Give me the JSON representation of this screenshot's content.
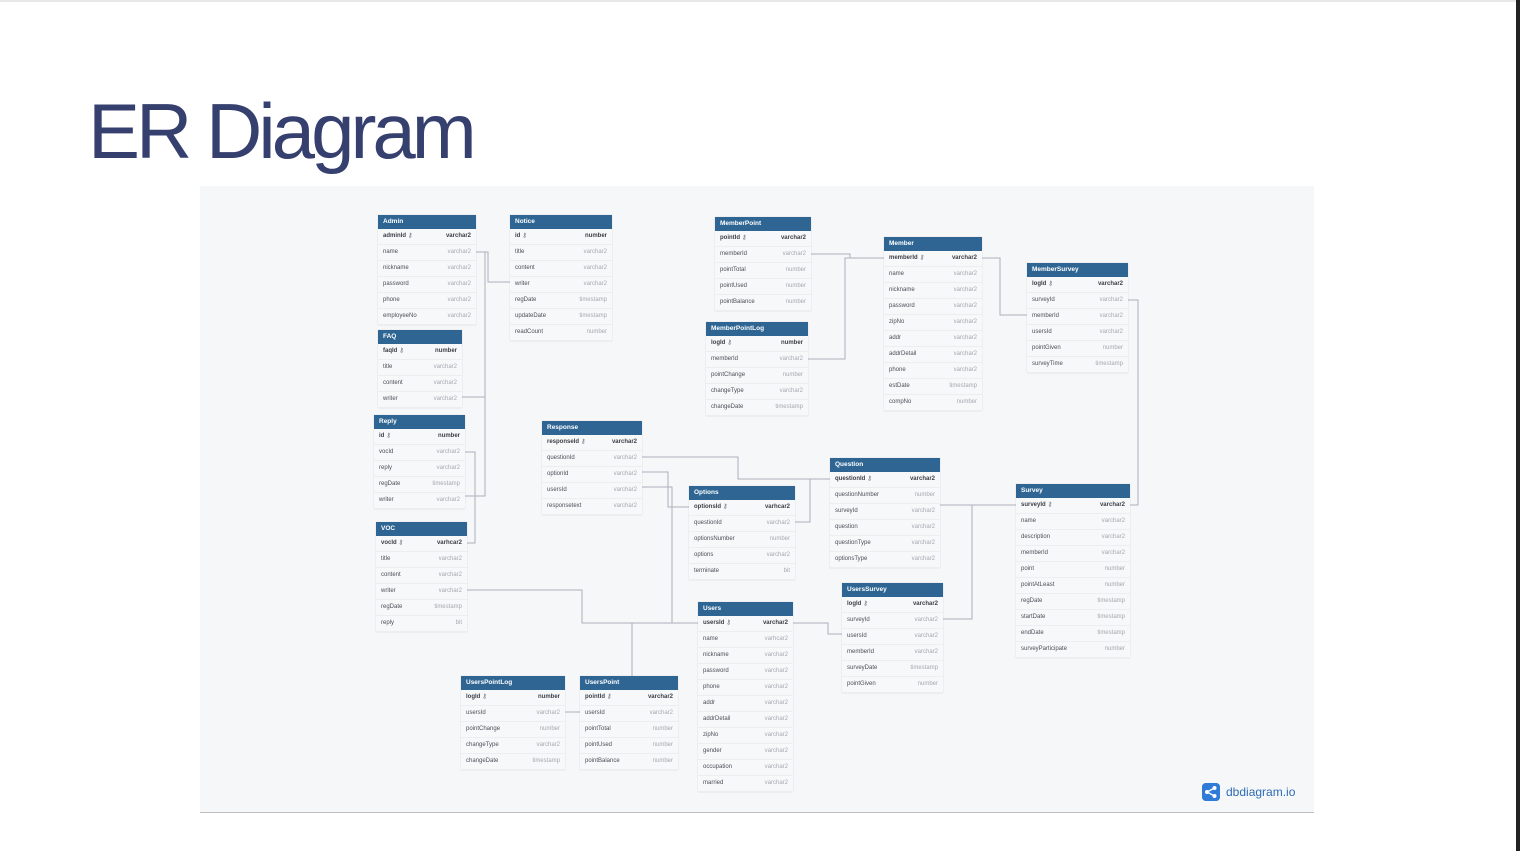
{
  "slide": {
    "title": "ER Diagram"
  },
  "brand": {
    "name": "dbdiagram.io",
    "icon": "share-nodes-icon",
    "color": "#2f7bd8"
  },
  "colors": {
    "title": "#36406f",
    "table_header": "#2e6593",
    "line": "#aab2bb"
  },
  "tables": [
    {
      "name": "Admin",
      "fields": [
        {
          "name": "adminId",
          "type": "varchar2",
          "pk": true
        },
        {
          "name": "name",
          "type": "varchar2"
        },
        {
          "name": "nickname",
          "type": "varchar2"
        },
        {
          "name": "password",
          "type": "varchar2"
        },
        {
          "name": "phone",
          "type": "varchar2"
        },
        {
          "name": "employeeNo",
          "type": "varchar2"
        }
      ]
    },
    {
      "name": "Notice",
      "fields": [
        {
          "name": "id",
          "type": "number",
          "pk": true
        },
        {
          "name": "title",
          "type": "varchar2"
        },
        {
          "name": "content",
          "type": "varchar2"
        },
        {
          "name": "writer",
          "type": "varchar2"
        },
        {
          "name": "regDate",
          "type": "timestamp"
        },
        {
          "name": "updateDate",
          "type": "timestamp"
        },
        {
          "name": "readCount",
          "type": "number"
        }
      ]
    },
    {
      "name": "FAQ",
      "fields": [
        {
          "name": "faqId",
          "type": "number",
          "pk": true
        },
        {
          "name": "title",
          "type": "varchar2"
        },
        {
          "name": "content",
          "type": "varchar2"
        },
        {
          "name": "writer",
          "type": "varchar2"
        }
      ]
    },
    {
      "name": "Reply",
      "fields": [
        {
          "name": "id",
          "type": "number",
          "pk": true
        },
        {
          "name": "vocId",
          "type": "varchar2"
        },
        {
          "name": "reply",
          "type": "varchar2"
        },
        {
          "name": "regDate",
          "type": "timestamp"
        },
        {
          "name": "writer",
          "type": "varchar2"
        }
      ]
    },
    {
      "name": "VOC",
      "fields": [
        {
          "name": "vocId",
          "type": "varhcar2",
          "pk": true
        },
        {
          "name": "title",
          "type": "varchar2"
        },
        {
          "name": "content",
          "type": "varchar2"
        },
        {
          "name": "writer",
          "type": "varchar2"
        },
        {
          "name": "regDate",
          "type": "timestamp"
        },
        {
          "name": "reply",
          "type": "bit"
        }
      ]
    },
    {
      "name": "MemberPoint",
      "fields": [
        {
          "name": "pointId",
          "type": "varchar2",
          "pk": true
        },
        {
          "name": "memberId",
          "type": "varchar2"
        },
        {
          "name": "pointTotal",
          "type": "number"
        },
        {
          "name": "pointUsed",
          "type": "number"
        },
        {
          "name": "pointBalance",
          "type": "number"
        }
      ]
    },
    {
      "name": "MemberPointLog",
      "fields": [
        {
          "name": "logId",
          "type": "number",
          "pk": true
        },
        {
          "name": "memberId",
          "type": "varchar2"
        },
        {
          "name": "pointChange",
          "type": "number"
        },
        {
          "name": "changeType",
          "type": "varchar2"
        },
        {
          "name": "changeDate",
          "type": "timestamp"
        }
      ]
    },
    {
      "name": "Member",
      "fields": [
        {
          "name": "memberId",
          "type": "varchar2",
          "pk": true
        },
        {
          "name": "name",
          "type": "varchar2"
        },
        {
          "name": "nickname",
          "type": "varchar2"
        },
        {
          "name": "password",
          "type": "varchar2"
        },
        {
          "name": "zipNo",
          "type": "varchar2"
        },
        {
          "name": "addr",
          "type": "varchar2"
        },
        {
          "name": "addrDetail",
          "type": "varchar2"
        },
        {
          "name": "phone",
          "type": "varchar2"
        },
        {
          "name": "estDate",
          "type": "timestamp"
        },
        {
          "name": "compNo",
          "type": "number"
        }
      ]
    },
    {
      "name": "MemberSurvey",
      "fields": [
        {
          "name": "logId",
          "type": "varchar2",
          "pk": true
        },
        {
          "name": "surveyId",
          "type": "varchar2"
        },
        {
          "name": "memberId",
          "type": "varchar2"
        },
        {
          "name": "usersId",
          "type": "varchar2"
        },
        {
          "name": "pointGiven",
          "type": "number"
        },
        {
          "name": "surveyTime",
          "type": "timestamp"
        }
      ]
    },
    {
      "name": "Response",
      "fields": [
        {
          "name": "responseId",
          "type": "varchar2",
          "pk": true
        },
        {
          "name": "questionId",
          "type": "varchar2"
        },
        {
          "name": "optionId",
          "type": "varchar2"
        },
        {
          "name": "usersId",
          "type": "varchar2"
        },
        {
          "name": "responsetext",
          "type": "varchar2"
        }
      ]
    },
    {
      "name": "Question",
      "fields": [
        {
          "name": "questionId",
          "type": "varchar2",
          "pk": true
        },
        {
          "name": "questionNumber",
          "type": "number"
        },
        {
          "name": "surveyId",
          "type": "varchar2"
        },
        {
          "name": "question",
          "type": "varchar2"
        },
        {
          "name": "questionType",
          "type": "varchar2"
        },
        {
          "name": "optionsType",
          "type": "varchar2"
        }
      ]
    },
    {
      "name": "Options",
      "fields": [
        {
          "name": "optionsId",
          "type": "varhcar2",
          "pk": true
        },
        {
          "name": "questionId",
          "type": "varchar2"
        },
        {
          "name": "optionsNumber",
          "type": "number"
        },
        {
          "name": "options",
          "type": "varchar2"
        },
        {
          "name": "terminate",
          "type": "bit"
        }
      ]
    },
    {
      "name": "Survey",
      "fields": [
        {
          "name": "surveyId",
          "type": "varchar2",
          "pk": true
        },
        {
          "name": "name",
          "type": "varchar2"
        },
        {
          "name": "description",
          "type": "varchar2"
        },
        {
          "name": "memberId",
          "type": "varchar2"
        },
        {
          "name": "point",
          "type": "number"
        },
        {
          "name": "pointAtLeast",
          "type": "number"
        },
        {
          "name": "regDate",
          "type": "timestamp"
        },
        {
          "name": "startDate",
          "type": "timestamp"
        },
        {
          "name": "endDate",
          "type": "timestamp"
        },
        {
          "name": "surveyParticipate",
          "type": "number"
        }
      ]
    },
    {
      "name": "UsersSurvey",
      "fields": [
        {
          "name": "logId",
          "type": "varchar2",
          "pk": true
        },
        {
          "name": "surveyId",
          "type": "varchar2"
        },
        {
          "name": "usersId",
          "type": "varchar2"
        },
        {
          "name": "memberId",
          "type": "varchar2"
        },
        {
          "name": "surveyDate",
          "type": "timestamp"
        },
        {
          "name": "pointGiven",
          "type": "number"
        }
      ]
    },
    {
      "name": "Users",
      "fields": [
        {
          "name": "usersId",
          "type": "varchar2",
          "pk": true
        },
        {
          "name": "name",
          "type": "varhcar2"
        },
        {
          "name": "nickname",
          "type": "varchar2"
        },
        {
          "name": "password",
          "type": "varchar2"
        },
        {
          "name": "phone",
          "type": "varchar2"
        },
        {
          "name": "addr",
          "type": "varchar2"
        },
        {
          "name": "addrDetail",
          "type": "varchar2"
        },
        {
          "name": "zipNo",
          "type": "varchar2"
        },
        {
          "name": "gender",
          "type": "varchar2"
        },
        {
          "name": "occupation",
          "type": "varchar2"
        },
        {
          "name": "married",
          "type": "varchar2"
        }
      ]
    },
    {
      "name": "UsersPointLog",
      "fields": [
        {
          "name": "logId",
          "type": "number",
          "pk": true
        },
        {
          "name": "usersId",
          "type": "varchar2"
        },
        {
          "name": "pointChange",
          "type": "number"
        },
        {
          "name": "changeType",
          "type": "varchar2"
        },
        {
          "name": "changeDate",
          "type": "timestamp"
        }
      ]
    },
    {
      "name": "UsersPoint",
      "fields": [
        {
          "name": "pointId",
          "type": "varchar2",
          "pk": true
        },
        {
          "name": "usersId",
          "type": "varchar2"
        },
        {
          "name": "pointTotal",
          "type": "number"
        },
        {
          "name": "pointUsed",
          "type": "number"
        },
        {
          "name": "pointBalance",
          "type": "number"
        }
      ]
    }
  ],
  "relationships": [
    {
      "from": "Admin.name",
      "to": "Notice.writer"
    },
    {
      "from": "Admin.name",
      "to": "FAQ.writer"
    },
    {
      "from": "Admin.name",
      "to": "Reply.writer"
    },
    {
      "from": "VOC.vocId",
      "to": "Reply.vocId"
    },
    {
      "from": "Member.memberId",
      "to": "MemberPoint.memberId"
    },
    {
      "from": "Member.memberId",
      "to": "MemberPointLog.memberId"
    },
    {
      "from": "Member.memberId",
      "to": "MemberSurvey.memberId"
    },
    {
      "from": "Survey.surveyId",
      "to": "MemberSurvey.surveyId"
    },
    {
      "from": "Question.questionId",
      "to": "Response.questionId"
    },
    {
      "from": "Options.optionsId",
      "to": "Response.optionId"
    },
    {
      "from": "Users.usersId",
      "to": "Response.usersId"
    },
    {
      "from": "Question.questionId",
      "to": "Options.questionId"
    },
    {
      "from": "Survey.surveyId",
      "to": "Question.surveyId"
    },
    {
      "from": "Survey.surveyId",
      "to": "UsersSurvey.surveyId"
    },
    {
      "from": "Users.usersId",
      "to": "UsersSurvey.usersId"
    },
    {
      "from": "Users.usersId",
      "to": "UsersPoint.usersId"
    },
    {
      "from": "UsersPoint.usersId",
      "to": "UsersPointLog.usersId"
    },
    {
      "from": "Users.usersId",
      "to": "VOC.writer"
    }
  ]
}
